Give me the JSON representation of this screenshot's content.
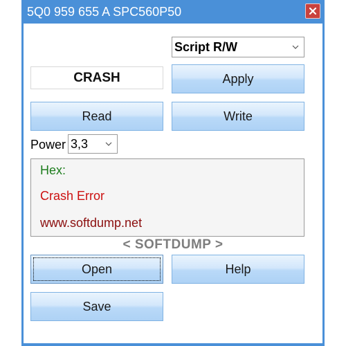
{
  "window": {
    "title": "5Q0 959 655 A SPC560P50"
  },
  "script_select": {
    "value": "Script R/W"
  },
  "crash_field": {
    "value": "CRASH"
  },
  "buttons": {
    "apply": "Apply",
    "read": "Read",
    "write": "Write",
    "open": "Open",
    "help": "Help",
    "save": "Save"
  },
  "power": {
    "label": "Power",
    "value": "3,3"
  },
  "info": {
    "hex_label": "Hex:",
    "status": "Crash Error",
    "website": "www.softdump.net"
  },
  "brand": {
    "text": "< SOFTDUMP >"
  },
  "colors": {
    "title_bar": "#4a90d8",
    "hex_text": "#1e7d1e",
    "status_text": "#cc1111",
    "website_text": "#8b0e0e",
    "brand_text": "#7d7d7d",
    "close_button": "#c9423e"
  },
  "icons": [
    "close-icon",
    "chevron-down-icon"
  ]
}
